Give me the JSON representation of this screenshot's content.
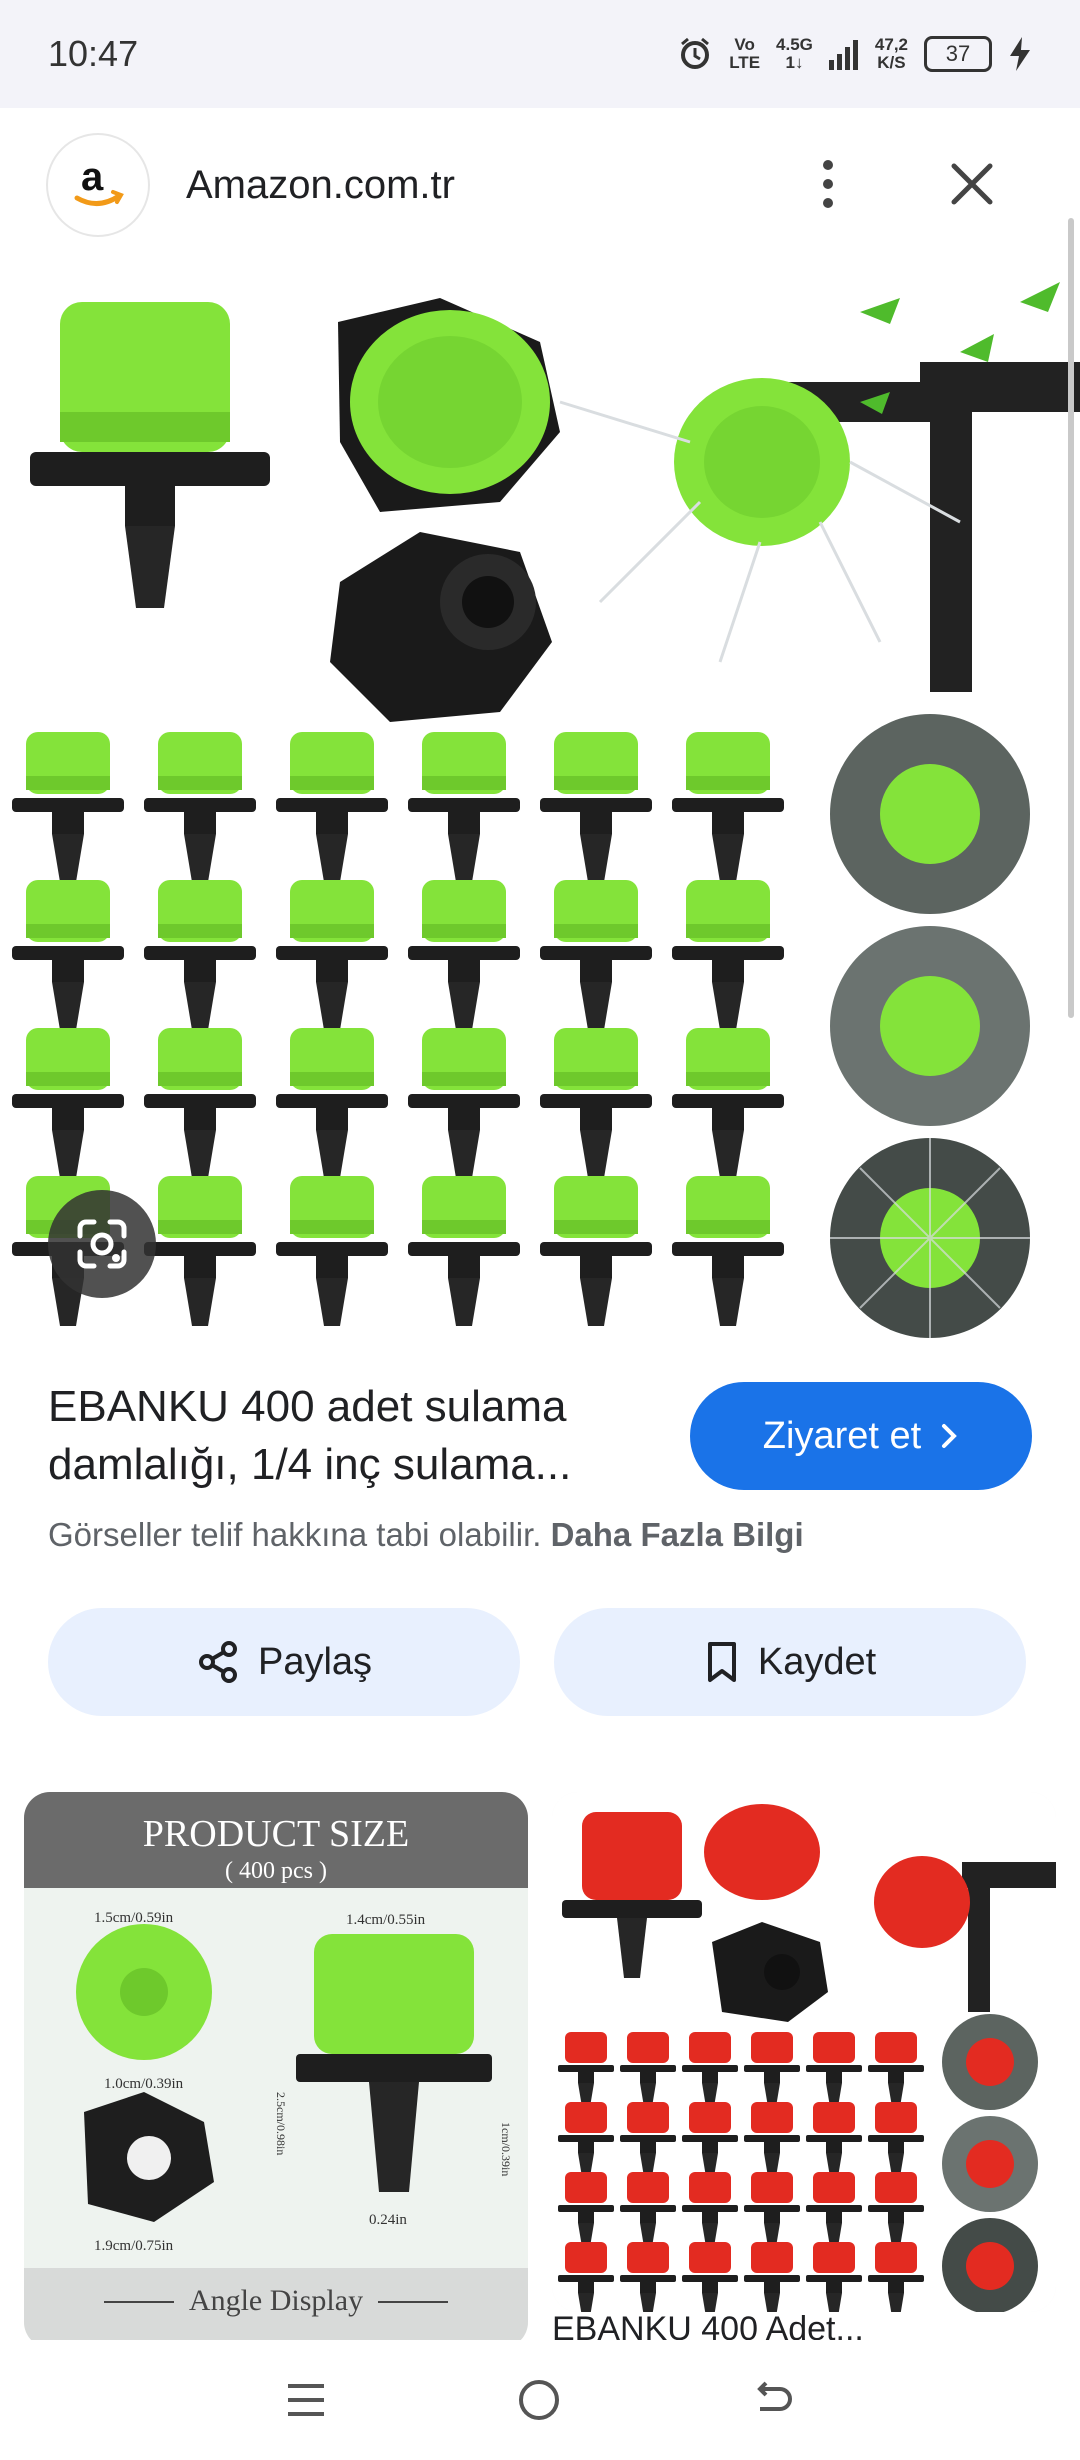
{
  "status": {
    "time": "10:47",
    "network_top": "Vo",
    "network_bottom": "LTE",
    "signal_top": "4.5G",
    "signal_bottom": "1↓",
    "speed_top": "47,2",
    "speed_bottom": "K/S",
    "battery": "37"
  },
  "header": {
    "site_name": "Amazon.com.tr"
  },
  "product": {
    "title_line1": "EBANKU 400 adet sulama",
    "title_line2": "damlalığı, 1/4 inç sulama...",
    "visit_label": "Ziyaret et",
    "copyright_text": "Görseller telif hakkına tabi olabilir.",
    "copyright_link": "Daha Fazla Bilgi"
  },
  "actions": {
    "share_label": "Paylaş",
    "save_label": "Kaydet"
  },
  "related": {
    "card1": {
      "heading": "PRODUCT SIZE",
      "sub": "( 400 pcs )",
      "dim1": "1.5cm/0.59in",
      "dim2": "1.4cm/0.55in",
      "dim3": "1.0cm/0.39in",
      "dim4": "2.5cm/0.98in",
      "dim5": "1cm/0.39in",
      "dim6": "1.9cm/0.75in",
      "dim7": "0.24in",
      "angle": "Angle Display"
    },
    "card2": {
      "title": "EBANKU 400 Adet..."
    }
  },
  "colors": {
    "accent": "#1a73e8",
    "product_green": "#84e33a",
    "product_red": "#e32b21"
  }
}
